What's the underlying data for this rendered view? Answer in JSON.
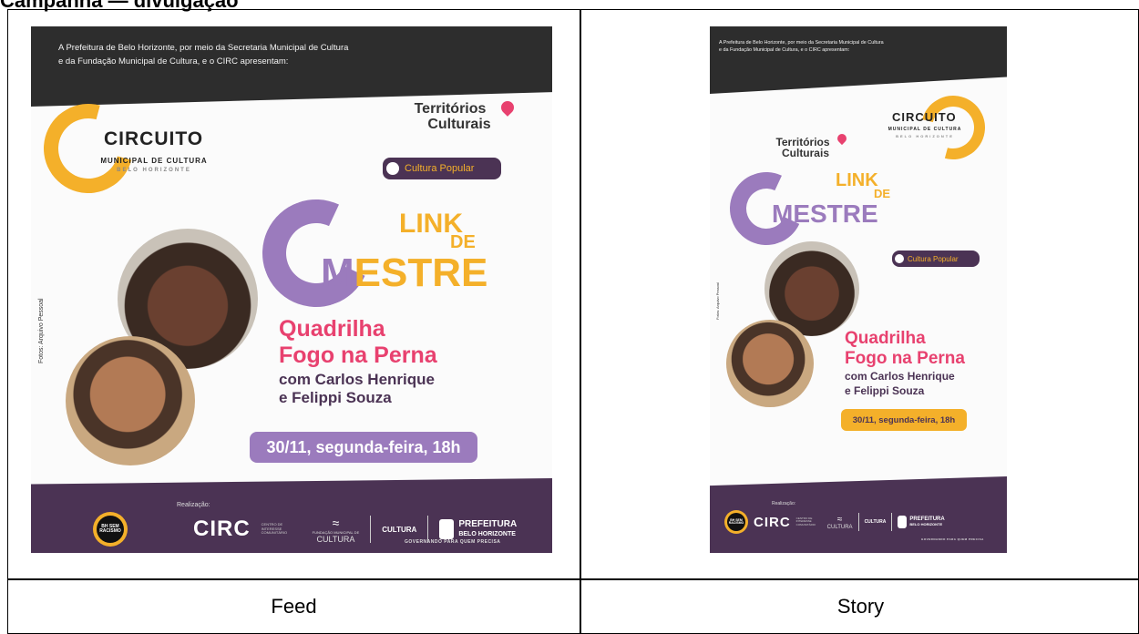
{
  "document": {
    "title": "Campanha — divulgação",
    "captions": {
      "feed": "Feed",
      "story": "Story"
    }
  },
  "poster": {
    "intro_line1": "A Prefeitura de Belo Horizonte, por meio da Secretaria Municipal de Cultura",
    "intro_line2": "e da Fundação Municipal de Cultura, e o CIRC apresentam:",
    "circuito": "CIRCUITO",
    "circuito_sub": "MUNICIPAL DE CULTURA",
    "circuito_bh": "BELO HORIZONTE",
    "territorios_line1": "Territórios",
    "territorios_line2": "Culturais",
    "category": "Cultura Popular",
    "link": "LINK",
    "de": "DE",
    "mestre": "MESTRE",
    "quadrilha_line1": "Quadrilha",
    "quadrilha_line2": "Fogo na Perna",
    "com_line1": "com Carlos Henrique",
    "com_line2": "e  Felippi Souza",
    "date": "30/11, segunda-feira, 18h",
    "photo_credit": "Fotos: Arquivo Pessoal",
    "antiracism": "BH SEM RACISMO",
    "realizacao": "Realização:",
    "circ": "CIRC",
    "circ_note": "CENTRO DE INTERESSE COMUNITÁRIO",
    "fmc": "FUNDAÇÃO MUNICIPAL DE",
    "fmc_cultura": "CULTURA",
    "cultura": "CULTURA",
    "prefeitura": "PREFEITURA",
    "belo_horizonte": "BELO HORIZONTE",
    "governando": "GOVERNANDO PARA QUEM PRECISA"
  },
  "colors": {
    "purple": "#4b3354",
    "lavender": "#9b7bbd",
    "yellow": "#f4b02a",
    "pink": "#e8416f",
    "dark": "#2d2d2d"
  }
}
